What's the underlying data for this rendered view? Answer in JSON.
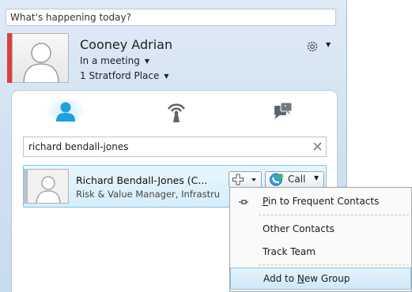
{
  "status_note": {
    "placeholder": "What's happening today?"
  },
  "profile": {
    "name": "Cooney Adrian",
    "status": "In a meeting",
    "location": "1 Stratford Place",
    "presence_color": "#d9423a"
  },
  "tabs": [
    {
      "name": "contacts",
      "icon": "person-icon"
    },
    {
      "name": "activity",
      "icon": "broadcast-icon"
    },
    {
      "name": "conversations",
      "icon": "chat-icon"
    }
  ],
  "search": {
    "value": "richard bendall-jones"
  },
  "result": {
    "name": "Richard Bendall-Jones  (C...",
    "title": "Risk & Value Manager, Infrastru"
  },
  "buttons": {
    "call_label": "Call"
  },
  "menu": {
    "items": [
      {
        "pre": "",
        "accel": "P",
        "post": "in to Frequent Contacts"
      },
      {
        "label": "Other Contacts"
      },
      {
        "label": "Track Team"
      },
      {
        "pre": "Add to ",
        "accel": "N",
        "post": "ew Group"
      }
    ]
  },
  "colors": {
    "accent": "#29a8e0",
    "selection": "#d7eefb"
  }
}
